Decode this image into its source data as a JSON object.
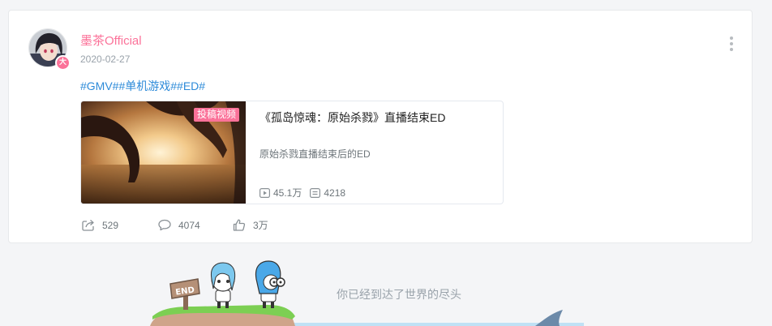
{
  "post": {
    "username": "墨茶Official",
    "date": "2020-02-27",
    "vip_badge": "大",
    "tags": [
      "#GMV#",
      "#单机游戏#",
      "#ED#"
    ],
    "video": {
      "badge": "投稿视频",
      "title": "《孤岛惊魂：原始杀戮》直播结束ED",
      "description": "原始杀戮直播结束后的ED",
      "views": "45.1万",
      "danmaku": "4218"
    },
    "actions": {
      "shares": "529",
      "comments": "4074",
      "likes": "3万"
    }
  },
  "footer": {
    "end_message": "你已经到达了世界的尽头",
    "sign_text": "END"
  },
  "colors": {
    "username": "#fb7299",
    "tag": "#2e8bd9",
    "badge": "#fb7299"
  },
  "icons": {
    "more": "more-vertical-icon",
    "play": "play-icon",
    "danmaku": "danmaku-icon",
    "share": "share-icon",
    "comment": "comment-icon",
    "like": "like-icon"
  }
}
